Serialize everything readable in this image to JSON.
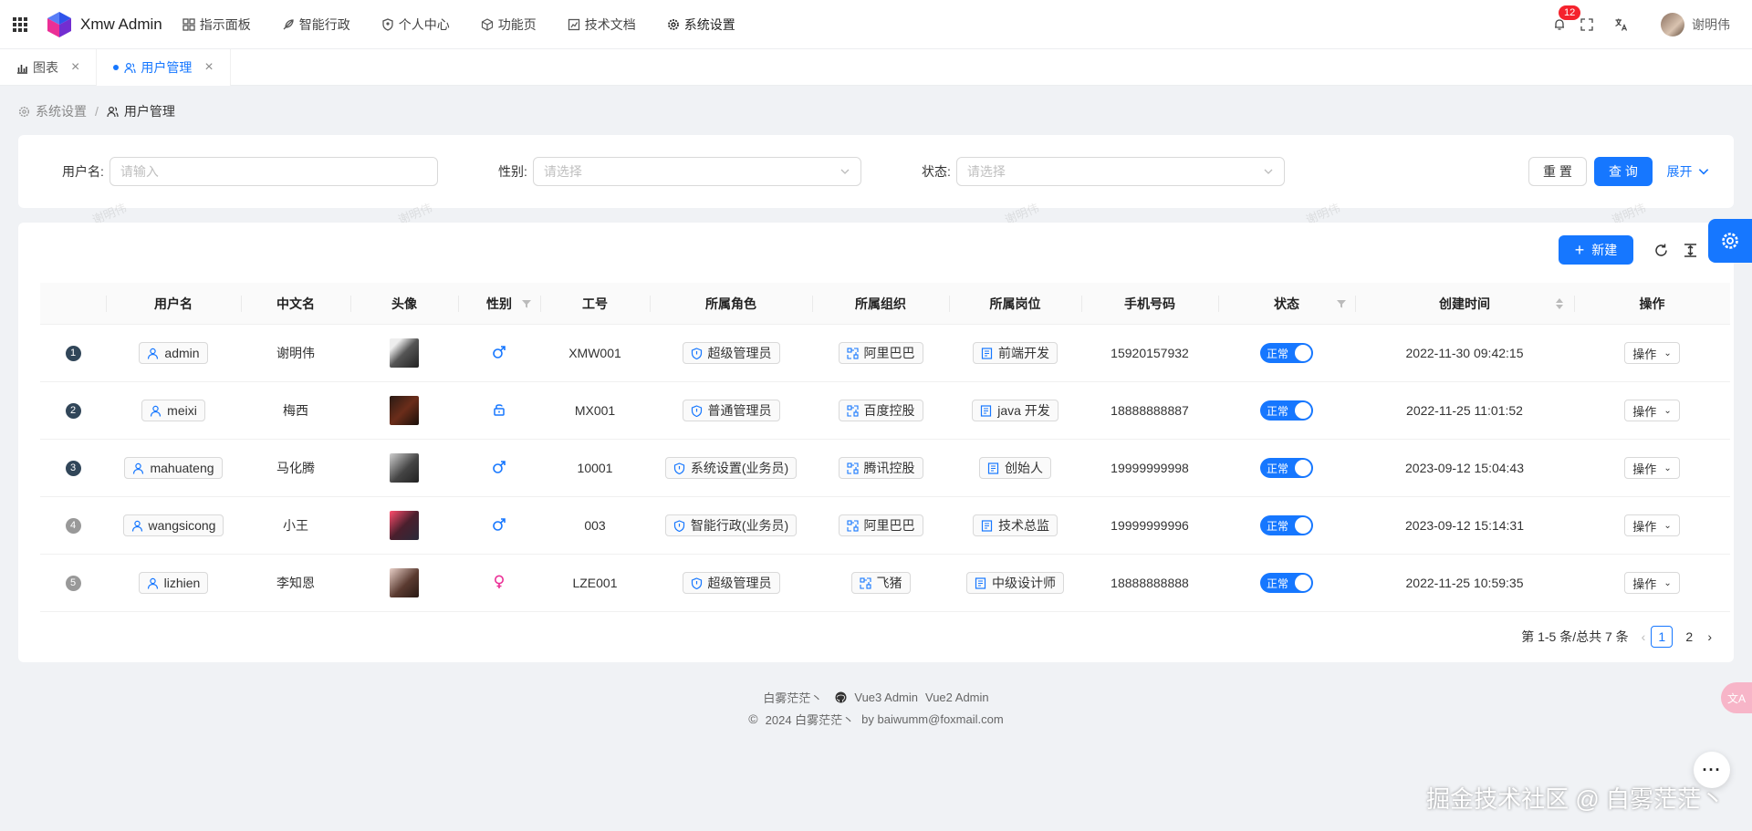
{
  "app": {
    "title": "Xmw Admin"
  },
  "nav": [
    {
      "label": "指示面板",
      "icon": "dashboard-icon"
    },
    {
      "label": "智能行政",
      "icon": "feather-icon"
    },
    {
      "label": "个人中心",
      "icon": "shield-user-icon"
    },
    {
      "label": "功能页",
      "icon": "cube-icon"
    },
    {
      "label": "技术文档",
      "icon": "chart-doc-icon"
    },
    {
      "label": "系统设置",
      "icon": "gear-icon"
    }
  ],
  "header": {
    "notification_count": "12",
    "user_name": "谢明伟"
  },
  "tabs": [
    {
      "label": "图表",
      "icon": "bar-chart-icon"
    },
    {
      "label": "用户管理",
      "icon": "users-icon"
    }
  ],
  "breadcrumb": {
    "parent": "系统设置",
    "current": "用户管理",
    "separator": "/"
  },
  "search": {
    "username_label": "用户名:",
    "username_placeholder": "请输入",
    "gender_label": "性别:",
    "gender_placeholder": "请选择",
    "status_label": "状态:",
    "status_placeholder": "请选择",
    "reset_label": "重 置",
    "query_label": "查 询",
    "expand_label": "展开"
  },
  "watermark": "谢明伟",
  "toolbar": {
    "new_label": "新建"
  },
  "table": {
    "columns": [
      "",
      "用户名",
      "中文名",
      "头像",
      "性别",
      "工号",
      "所属角色",
      "所属组织",
      "所属岗位",
      "手机号码",
      "状态",
      "创建时间",
      "操作"
    ],
    "rows": [
      {
        "index": "1",
        "username": "admin",
        "cn_name": "谢明伟",
        "gender": "male",
        "job_no": "XMW001",
        "role": "超级管理员",
        "org": "阿里巴巴",
        "post": "前端开发",
        "phone": "15920157932",
        "status": "正常",
        "created": "2022-11-30 09:42:15",
        "op": "操作"
      },
      {
        "index": "2",
        "username": "meixi",
        "cn_name": "梅西",
        "gender": "unknown",
        "job_no": "MX001",
        "role": "普通管理员",
        "org": "百度控股",
        "post": "java 开发",
        "phone": "18888888887",
        "status": "正常",
        "created": "2022-11-25 11:01:52",
        "op": "操作"
      },
      {
        "index": "3",
        "username": "mahuateng",
        "cn_name": "马化腾",
        "gender": "male",
        "job_no": "10001",
        "role": "系统设置(业务员)",
        "org": "腾讯控股",
        "post": "创始人",
        "phone": "19999999998",
        "status": "正常",
        "created": "2023-09-12 15:04:43",
        "op": "操作"
      },
      {
        "index": "4",
        "username": "wangsicong",
        "cn_name": "小王",
        "gender": "male",
        "job_no": "003",
        "role": "智能行政(业务员)",
        "org": "阿里巴巴",
        "post": "技术总监",
        "phone": "19999999996",
        "status": "正常",
        "created": "2023-09-12 15:14:31",
        "op": "操作"
      },
      {
        "index": "5",
        "username": "lizhien",
        "cn_name": "李知恩",
        "gender": "female",
        "job_no": "LZE001",
        "role": "超级管理员",
        "org": "飞猪",
        "post": "中级设计师",
        "phone": "18888888888",
        "status": "正常",
        "created": "2022-11-25 10:59:35",
        "op": "操作"
      }
    ]
  },
  "pagination": {
    "summary": "第 1-5 条/总共 7 条",
    "pages": [
      "1",
      "2"
    ],
    "current": "1"
  },
  "footer": {
    "author": "白雾茫茫丶",
    "links": [
      "Vue3 Admin",
      "Vue2 Admin"
    ],
    "copyright": "2024 白雾茫茫丶",
    "by": "by baiwumm@foxmail.com"
  },
  "overlay": {
    "community": "掘金技术社区 @ 白雾茫茫丶",
    "translate_label": "文A",
    "more_label": "···"
  },
  "colors": {
    "primary": "#1677ff",
    "male": "#1677ff",
    "female": "#eb2f96"
  }
}
